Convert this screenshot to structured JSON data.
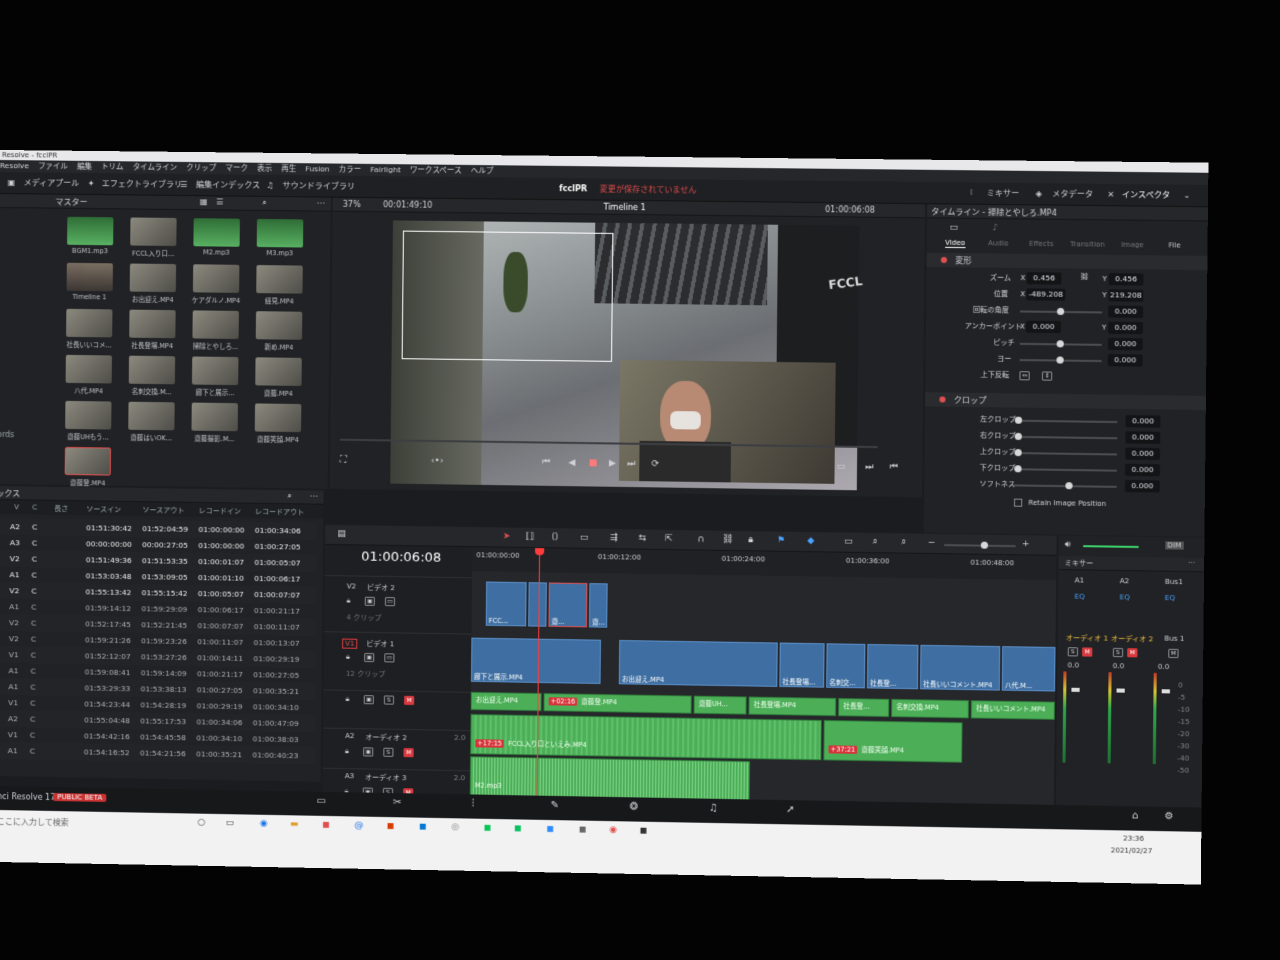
{
  "window": {
    "title": "Resolve - fcclPR",
    "project": "fcclPR",
    "unsaved_status": "変更が保存されていません"
  },
  "menu": [
    "Resolve",
    "ファイル",
    "編集",
    "トリム",
    "タイムライン",
    "クリップ",
    "マーク",
    "表示",
    "再生",
    "Fusion",
    "カラー",
    "Fairlight",
    "ワークスペース",
    "ヘルプ"
  ],
  "toolbar": {
    "media_pool": "メディアプール",
    "effects_library": "エフェクトライブラリ",
    "edit_index": "編集インデックス",
    "sound_library": "サウンドライブラリ",
    "mixer": "ミキサー",
    "metadata": "メタデータ",
    "inspector": "インスペクタ"
  },
  "media_pool": {
    "bin": "マスター",
    "left_label": "ords",
    "items": [
      {
        "name": "BGM1.mp3",
        "kind": "audio"
      },
      {
        "name": "FCCL入り口...",
        "kind": "video"
      },
      {
        "name": "M2.mp3",
        "kind": "audio"
      },
      {
        "name": "M3.mp3",
        "kind": "audio"
      },
      {
        "name": "Timeline 1",
        "kind": "timeline"
      },
      {
        "name": "お出迎え.MP4",
        "kind": "video"
      },
      {
        "name": "ケアダルノ.MP4",
        "kind": "video"
      },
      {
        "name": "経見.MP4",
        "kind": "video"
      },
      {
        "name": "社長いいコメ...",
        "kind": "video"
      },
      {
        "name": "社長登場.MP4",
        "kind": "video"
      },
      {
        "name": "掃除とやしろ...",
        "kind": "video"
      },
      {
        "name": "新め.MP4",
        "kind": "video"
      },
      {
        "name": "八代.MP4",
        "kind": "video"
      },
      {
        "name": "名刺交換.M...",
        "kind": "video"
      },
      {
        "name": "廊下と展示...",
        "kind": "video"
      },
      {
        "name": "齋藤.MP4",
        "kind": "video"
      },
      {
        "name": "齋藤UHもう...",
        "kind": "video"
      },
      {
        "name": "齋藤はいOK...",
        "kind": "video"
      },
      {
        "name": "齋藤撮影.M...",
        "kind": "video"
      },
      {
        "name": "齋藤笑顔.MP4",
        "kind": "video"
      },
      {
        "name": "齋藤登.MP4",
        "kind": "video"
      }
    ]
  },
  "edit_index": {
    "title": "ックス",
    "columns": [
      "V",
      "C",
      "長さ",
      "ソースイン",
      "ソースアウト",
      "レコードイン",
      "レコードアウト"
    ],
    "rows": [
      [
        "A2",
        "C",
        "01:51:30:42",
        "01:52:04:59",
        "01:00:00:00",
        "01:00:34:06"
      ],
      [
        "A3",
        "C",
        "00:00:00:00",
        "00:00:27:05",
        "01:00:00:00",
        "01:00:27:05"
      ],
      [
        "V2",
        "C",
        "01:51:49:36",
        "01:51:53:35",
        "01:00:01:07",
        "01:00:05:07"
      ],
      [
        "A1",
        "C",
        "01:53:03:48",
        "01:53:09:05",
        "01:00:01:10",
        "01:00:06:17"
      ],
      [
        "V2",
        "C",
        "01:55:13:42",
        "01:55:15:42",
        "01:00:05:07",
        "01:00:07:07"
      ],
      [
        "A1",
        "C",
        "01:59:14:12",
        "01:59:29:09",
        "01:00:06:17",
        "01:00:21:17"
      ],
      [
        "V2",
        "C",
        "01:52:17:45",
        "01:52:21:45",
        "01:00:07:07",
        "01:00:11:07"
      ],
      [
        "V2",
        "C",
        "01:59:21:26",
        "01:59:23:26",
        "01:00:11:07",
        "01:00:13:07"
      ],
      [
        "V1",
        "C",
        "01:52:12:07",
        "01:53:27:26",
        "01:00:14:11",
        "01:00:29:19"
      ],
      [
        "A1",
        "C",
        "01:59:08:41",
        "01:59:14:09",
        "01:00:21:17",
        "01:00:27:05"
      ],
      [
        "A1",
        "C",
        "01:53:29:33",
        "01:53:38:13",
        "01:00:27:05",
        "01:00:35:21"
      ],
      [
        "V1",
        "C",
        "01:54:23:44",
        "01:54:28:19",
        "01:00:29:19",
        "01:00:34:10"
      ],
      [
        "A2",
        "C",
        "01:55:04:48",
        "01:55:17:53",
        "01:00:34:06",
        "01:00:47:09"
      ],
      [
        "V1",
        "C",
        "01:54:42:16",
        "01:54:45:58",
        "01:00:34:10",
        "01:00:38:03"
      ],
      [
        "A1",
        "C",
        "01:54:16:52",
        "01:54:21:56",
        "01:00:35:21",
        "01:00:40:23"
      ]
    ]
  },
  "viewer": {
    "zoom": "37%",
    "source_tc": "00:01:49:10",
    "timeline_name": "Timeline 1",
    "record_tc": "01:00:06:08"
  },
  "inspector": {
    "title": "タイムライン - 掃除とやしろ.MP4",
    "tabs": [
      "Video",
      "Audio",
      "Effects",
      "Transition",
      "Image",
      "File"
    ],
    "transform": {
      "title": "変形",
      "zoom_label": "ズーム",
      "zoom_x": "0.456",
      "zoom_y": "0.456",
      "pos_label": "位置",
      "pos_x": "-489.208",
      "pos_y": "219.208",
      "rot_label": "回転の角度",
      "rot": "0.000",
      "anchor_label": "アンカーポイント",
      "anchor_x": "0.000",
      "anchor_y": "0.000",
      "pitch_label": "ピッチ",
      "pitch": "0.000",
      "yaw_label": "ヨー",
      "yaw": "0.000",
      "flip_label": "上下反転"
    },
    "crop": {
      "title": "クロップ",
      "left_label": "左クロップ",
      "left": "0.000",
      "right_label": "右クロップ",
      "right": "0.000",
      "top_label": "上クロップ",
      "top": "0.000",
      "bottom_label": "下クロップ",
      "bottom": "0.000",
      "soft_label": "ソフトネス",
      "soft": "0.000",
      "retain": "Retain Image Position"
    }
  },
  "timeline": {
    "timecode": "01:00:06:08",
    "ruler": [
      "01:00:00:00",
      "01:00:12:00",
      "01:00:24:00",
      "01:00:36:00",
      "01:00:48:00"
    ],
    "tracks": {
      "v2": {
        "id": "V2",
        "name": "ビデオ 2",
        "count": "4 クリップ"
      },
      "v1": {
        "id": "V1",
        "name": "ビデオ 1",
        "count": "12 クリップ"
      },
      "a1": {
        "id": "A1"
      },
      "a2": {
        "id": "A2",
        "name": "オーディオ 2",
        "ch": "2.0"
      },
      "a3": {
        "id": "A3",
        "name": "オーディオ 3",
        "ch": "2.0"
      }
    },
    "v2_clips": [
      "FCC...",
      "齋...",
      "齋..."
    ],
    "v1_clips": [
      "廊下と展示.MP4",
      "お出迎え.MP4",
      "社長登場...",
      "名刺交...",
      "社長登...",
      "社長いいコメント.MP4",
      "八代.M..."
    ],
    "a1_clips": [
      "お出迎え.MP4",
      "齋藤登.MP4",
      "齋藤UH...",
      "社長登場.MP4",
      "社長登...",
      "名刺交換.MP4",
      "社長いいコメント.MP4"
    ],
    "a1_tag": "+02:16",
    "a2_tag": "+17:15",
    "a2_clip": "FCCL入り口といえみ.MP4",
    "a2_tag2": "+37:21",
    "a2_clip2": "齋藤笑顔.MP4",
    "a3_clip": "M2.mp3"
  },
  "mixer": {
    "title": "ミキサー",
    "ch": [
      "A1",
      "A2",
      "Bus1"
    ],
    "eq": "EQ",
    "names": [
      "オーディオ 1",
      "オーディオ 2",
      "Bus 1"
    ],
    "db": "0.0",
    "dim": "DIM",
    "scale": [
      "0",
      "-5",
      "-10",
      "-15",
      "-20",
      "-30",
      "-40",
      "-50"
    ]
  },
  "footer": {
    "app": "nci Resolve 17",
    "badge": "PUBLIC BETA"
  },
  "taskbar": {
    "search": "ここに入力して検索",
    "time": "23:36",
    "date": "2021/02/27"
  }
}
